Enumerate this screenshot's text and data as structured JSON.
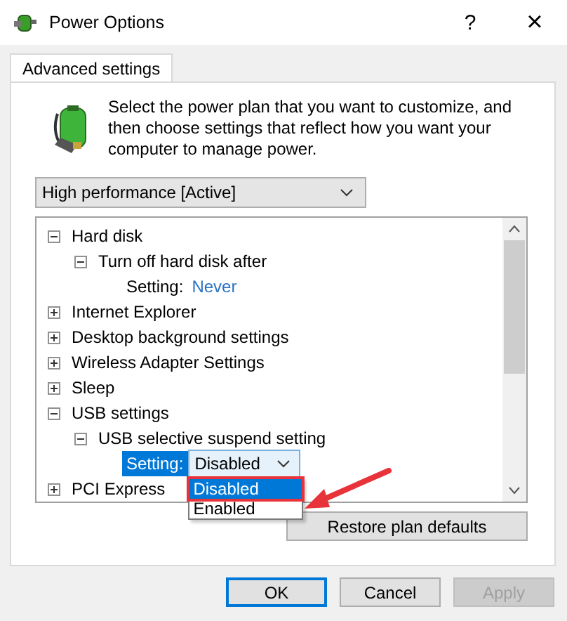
{
  "window": {
    "title": "Power Options",
    "help": "?",
    "close": "×"
  },
  "tabs": [
    {
      "label": "Advanced settings",
      "selected": true
    }
  ],
  "intro": "Select the power plan that you want to customize, and then choose settings that reflect how you want your computer to manage power.",
  "plan": {
    "value": "High performance [Active]"
  },
  "tree": [
    {
      "label": "Hard disk",
      "expanded": true,
      "children": [
        {
          "label": "Turn off hard disk after",
          "expanded": true,
          "children": [
            {
              "kind": "value",
              "label": "Setting:",
              "value": "Never"
            }
          ]
        }
      ]
    },
    {
      "label": "Internet Explorer",
      "expanded": false
    },
    {
      "label": "Desktop background settings",
      "expanded": false
    },
    {
      "label": "Wireless Adapter Settings",
      "expanded": false
    },
    {
      "label": "Sleep",
      "expanded": false
    },
    {
      "label": "USB settings",
      "expanded": true,
      "children": [
        {
          "label": "USB selective suspend setting",
          "expanded": true,
          "children": [
            {
              "kind": "dropdown",
              "label": "Setting:",
              "value": "Disabled",
              "selected": true,
              "options": [
                {
                  "label": "Disabled",
                  "selected": true
                },
                {
                  "label": "Enabled",
                  "selected": false
                }
              ]
            }
          ]
        }
      ]
    },
    {
      "label": "PCI Express",
      "expanded": false
    }
  ],
  "restore_button": "Restore plan defaults",
  "buttons": [
    {
      "label": "OK",
      "disabled": false,
      "default": true
    },
    {
      "label": "Cancel",
      "disabled": false,
      "default": false
    },
    {
      "label": "Apply",
      "disabled": true,
      "default": false
    }
  ]
}
